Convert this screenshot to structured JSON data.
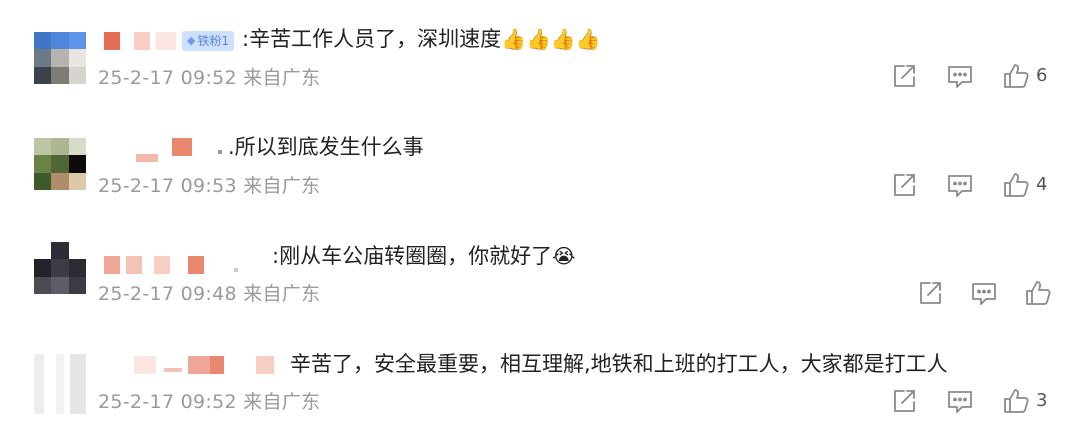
{
  "comments": [
    {
      "badge": "铁粉1",
      "text": ":辛苦工作人员了，深圳速度",
      "emojis": [
        "👍",
        "👍",
        "👍",
        "👍"
      ],
      "meta": "25-2-17 09:52 来自广东",
      "like_count": "6"
    },
    {
      "text": ".所以到底发生什么事",
      "emojis": [],
      "meta": "25-2-17 09:53 来自广东",
      "like_count": "4"
    },
    {
      "text": ":刚从车公庙转圈圈，你就好了",
      "emojis": [
        "😭"
      ],
      "meta": "25-2-17 09:48 来自广东",
      "like_count": ""
    },
    {
      "text": "辛苦了，安全最重要，相互理解,地铁和上班的打工人，大家都是打工人",
      "emojis": [],
      "meta": "25-2-17 09:52 来自广东",
      "like_count": "3"
    }
  ],
  "icons": {
    "share": "share-icon",
    "comment": "comment-icon",
    "like": "thumbs-up-icon",
    "badge": "diamond-icon"
  },
  "colors": {
    "text": "#222222",
    "meta": "#9a9a9a",
    "badge_bg": "#cfe0ff",
    "badge_text": "#5a86dd"
  }
}
